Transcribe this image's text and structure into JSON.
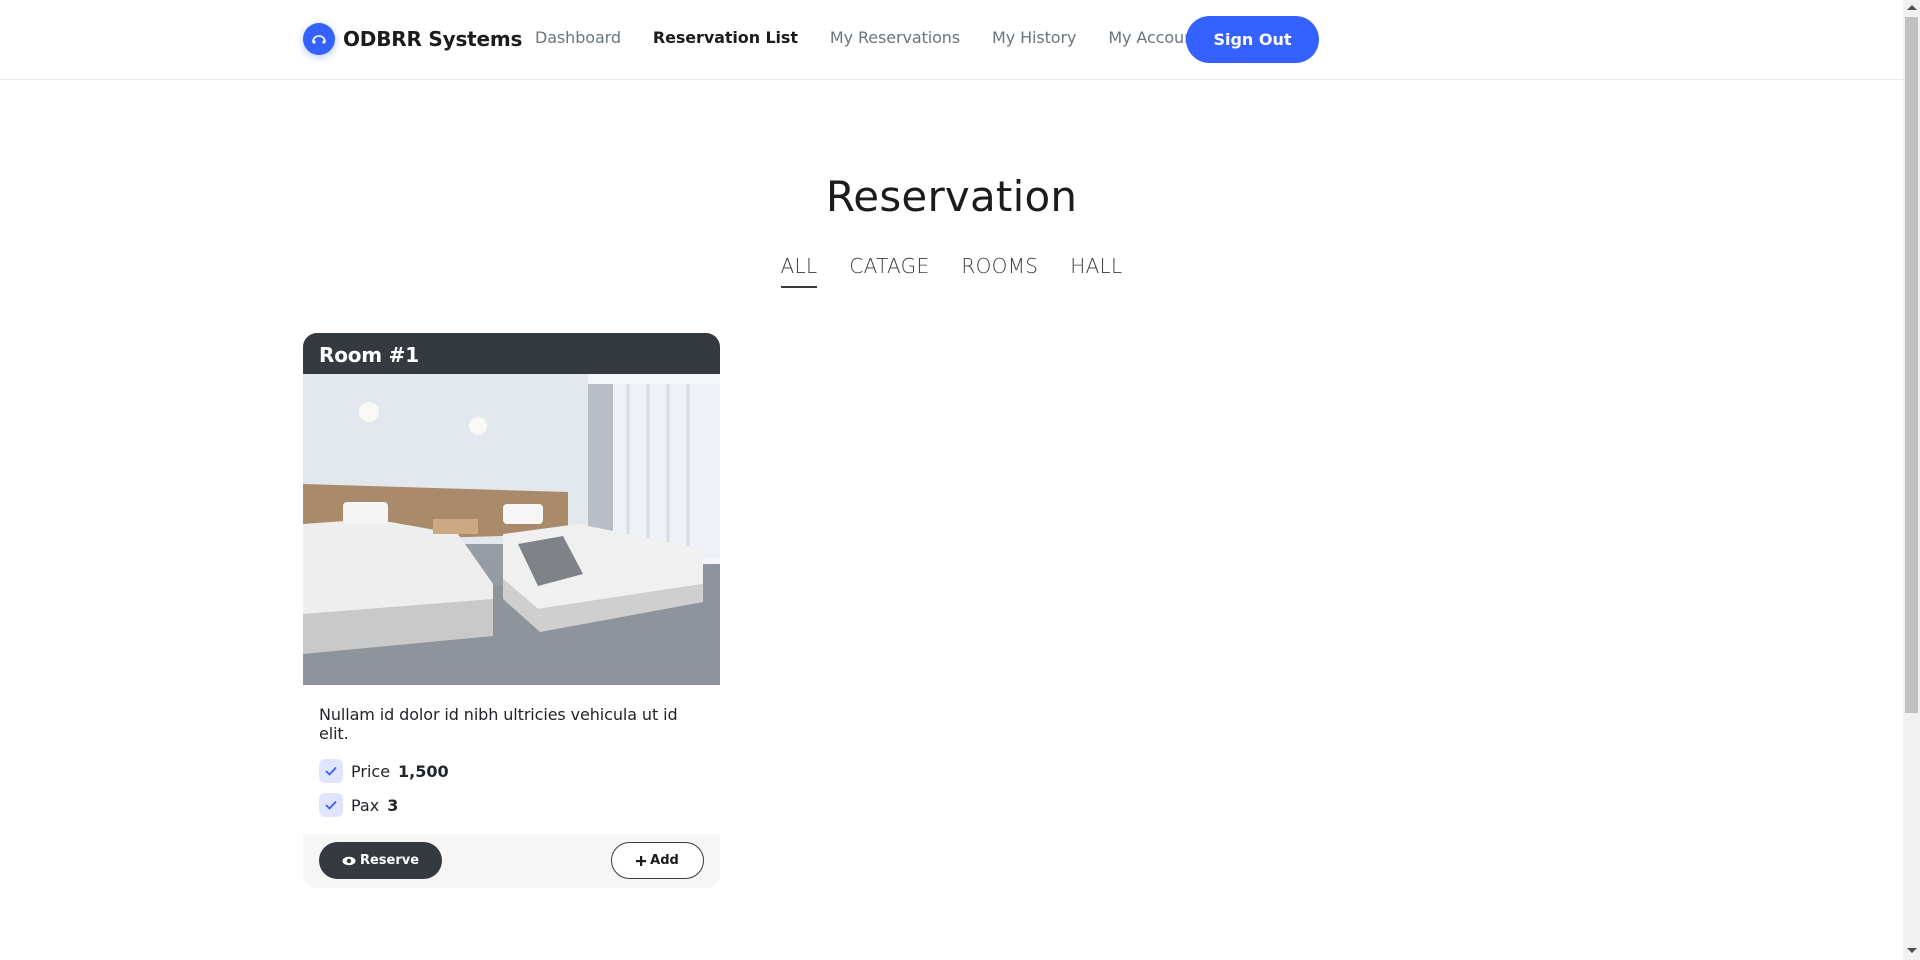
{
  "header": {
    "brand_name": "ODBRR Systems",
    "nav": [
      {
        "label": "Dashboard",
        "active": false
      },
      {
        "label": "Reservation List",
        "active": true
      },
      {
        "label": "My Reservations",
        "active": false
      },
      {
        "label": "My History",
        "active": false
      },
      {
        "label": "My Account",
        "active": false
      }
    ],
    "sign_out_label": "Sign Out"
  },
  "section": {
    "title": "Reservation",
    "filters": [
      {
        "label": "ALL",
        "active": true
      },
      {
        "label": "CATAGE",
        "active": false
      },
      {
        "label": "ROOMS",
        "active": false
      },
      {
        "label": "HALL",
        "active": false
      }
    ]
  },
  "cards": [
    {
      "title": "Room #1",
      "description": "Nullam id dolor id nibh ultricies vehicula ut id elit.",
      "features": [
        {
          "label": "Price",
          "value": "1,500"
        },
        {
          "label": "Pax",
          "value": "3"
        }
      ],
      "reserve_label": "Reserve",
      "add_label": "Add"
    }
  ],
  "colors": {
    "accent": "#3461ff",
    "dark": "#343a40"
  }
}
